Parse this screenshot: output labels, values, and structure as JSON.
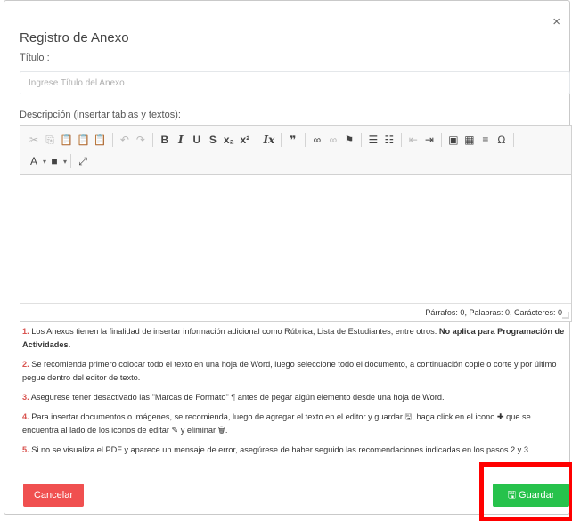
{
  "modal": {
    "close_glyph": "×",
    "title": "Registro de Anexo",
    "titulo_label": "Título :",
    "titulo_placeholder": "Ingrese Título del Anexo",
    "descripcion_label": "Descripción (insertar tablas y textos):"
  },
  "editor": {
    "toolbar_row1": [
      {
        "name": "cut-icon",
        "glyph": "✂",
        "disabled": true
      },
      {
        "name": "copy-icon",
        "glyph": "⎘",
        "disabled": true
      },
      {
        "name": "paste-icon",
        "glyph": "📋",
        "disabled": false
      },
      {
        "name": "paste-text-icon",
        "glyph": "📋",
        "disabled": false
      },
      {
        "name": "paste-word-icon",
        "glyph": "📋",
        "disabled": false
      },
      {
        "sep": true
      },
      {
        "name": "undo-icon",
        "glyph": "↶",
        "disabled": true
      },
      {
        "name": "redo-icon",
        "glyph": "↷",
        "disabled": true
      },
      {
        "sep": true
      },
      {
        "name": "bold-icon",
        "glyph": "B",
        "style": "bold"
      },
      {
        "name": "italic-icon",
        "glyph": "I",
        "style": "ital"
      },
      {
        "name": "underline-icon",
        "glyph": "U",
        "style": "bold"
      },
      {
        "name": "strike-icon",
        "glyph": "S",
        "style": "bold"
      },
      {
        "name": "subscript-icon",
        "glyph": "x₂",
        "style": "bold"
      },
      {
        "name": "superscript-icon",
        "glyph": "x²",
        "style": "bold"
      },
      {
        "sep": true
      },
      {
        "name": "remove-format-icon",
        "glyph": "Ix",
        "style": "ital"
      },
      {
        "sep": true
      },
      {
        "name": "blockquote-icon",
        "glyph": "❞",
        "style": "bold"
      },
      {
        "sep": true
      },
      {
        "name": "link-icon",
        "glyph": "∞"
      },
      {
        "name": "unlink-icon",
        "glyph": "∞",
        "disabled": true
      },
      {
        "name": "anchor-icon",
        "glyph": "⚑"
      },
      {
        "sep": true
      },
      {
        "name": "numbered-list-icon",
        "glyph": "☰"
      },
      {
        "name": "bulleted-list-icon",
        "glyph": "☷"
      },
      {
        "sep": true
      },
      {
        "name": "outdent-icon",
        "glyph": "⇤",
        "disabled": true
      },
      {
        "name": "indent-icon",
        "glyph": "⇥"
      },
      {
        "sep": true
      },
      {
        "name": "image-icon",
        "glyph": "▣"
      },
      {
        "name": "table-icon",
        "glyph": "▦"
      },
      {
        "name": "horizontal-line-icon",
        "glyph": "≡"
      },
      {
        "name": "special-char-icon",
        "glyph": "Ω"
      },
      {
        "sep": true
      }
    ],
    "toolbar_row2": [
      {
        "name": "text-color-icon",
        "glyph": "A",
        "drop": true
      },
      {
        "name": "bg-color-icon",
        "glyph": "■",
        "drop": true
      },
      {
        "sep": true
      },
      {
        "name": "maximize-icon",
        "glyph": "⤢"
      }
    ],
    "status": "Párrafos: 0, Palabras: 0, Carácteres: 0"
  },
  "notes": [
    {
      "num": "1.",
      "text": " Los Anexos tienen la finalidad de insertar información adicional como Rúbrica, Lista de Estudiantes, entre otros. ",
      "strong": "No aplica para Programación de Actividades."
    },
    {
      "num": "2.",
      "text": " Se recomienda primero colocar todo el texto en una hoja de Word, luego seleccione todo el documento, a continuación copie o corte y por último pegue dentro del editor de texto.",
      "strong": ""
    },
    {
      "num": "3.",
      "text": " Asegurese tener desactivado las \"Marcas de Formato\" ¶ antes de pegar algún elemento desde una hoja de Word.",
      "strong": ""
    },
    {
      "num": "4.",
      "text": " Para insertar documentos o imágenes, se recomienda, luego de agregar el texto en el editor y guardar 🖫, haga click en el icono ✚ que se encuentra al lado de los iconos de editar ✎ y eliminar 🗑.",
      "strong": ""
    },
    {
      "num": "5.",
      "text": " Si no se visualiza el PDF y aparece un mensaje de error, asegúrese de haber seguido las recomendaciones indicadas en los pasos 2 y 3.",
      "strong": ""
    }
  ],
  "buttons": {
    "cancel_label": "Cancelar",
    "save_icon": "🖫",
    "save_label": "Guardar"
  },
  "colors": {
    "cancel": "#f05050",
    "save": "#27c24c",
    "note_number": "#d9534f",
    "highlight": "#ff0000"
  }
}
